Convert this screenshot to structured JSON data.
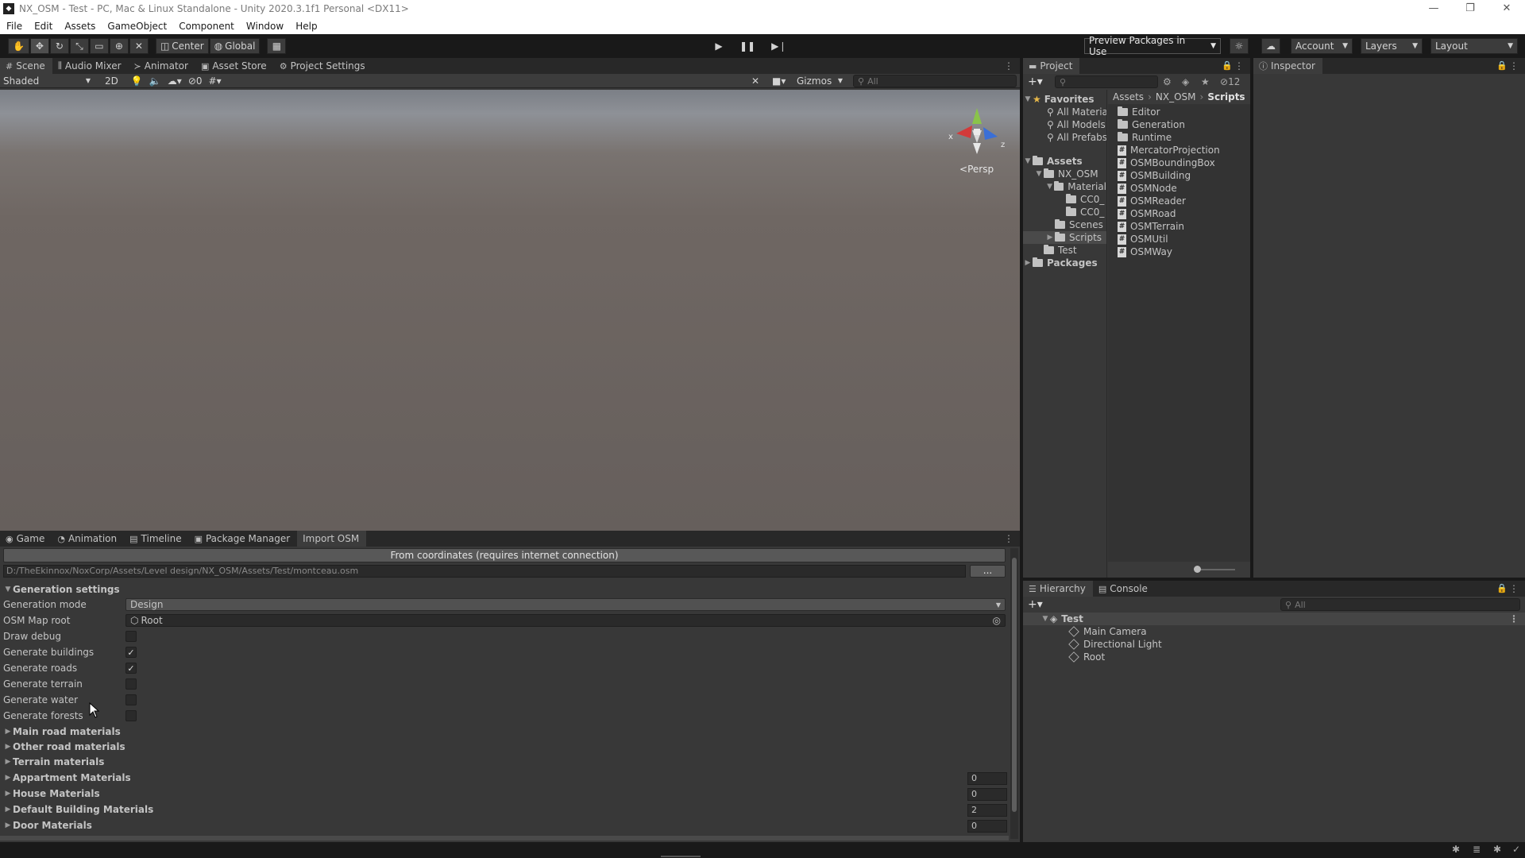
{
  "window": {
    "title": "NX_OSM - Test - PC, Mac & Linux Standalone - Unity 2020.3.1f1 Personal <DX11>",
    "controls": [
      "—",
      "❐",
      "✕"
    ]
  },
  "menu": [
    "File",
    "Edit",
    "Assets",
    "GameObject",
    "Component",
    "Window",
    "Help"
  ],
  "toolbar": {
    "pivot": "Center",
    "space": "Global",
    "preview_packages": "Preview Packages in Use",
    "account": "Account",
    "layers": "Layers",
    "layout": "Layout"
  },
  "scene": {
    "tabs": [
      "Scene",
      "Audio Mixer",
      "Animator",
      "Asset Store",
      "Project Settings"
    ],
    "shading_mode": "Shaded",
    "mode_2d": "2D",
    "hidden_count": "0",
    "gizmos": "Gizmos",
    "search_placeholder": "All",
    "persp_label": "Persp",
    "axis_x": "x",
    "axis_z": "z"
  },
  "bottom": {
    "tabs": [
      "Game",
      "Animation",
      "Timeline",
      "Package Manager",
      "Import OSM"
    ],
    "coords_button": "From coordinates (requires internet connection)",
    "file_path": "D:/TheEkinnox/NoxCorp/Assets/Level design/NX_OSM/Assets/Test/montceau.osm",
    "browse": "...",
    "generation_settings": "Generation settings",
    "props": [
      {
        "label": "Generation mode",
        "value": "Design"
      },
      {
        "label": "OSM Map root",
        "value": "Root"
      }
    ],
    "toggles": [
      {
        "label": "Draw debug",
        "checked": false
      },
      {
        "label": "Generate buildings",
        "checked": true
      },
      {
        "label": "Generate roads",
        "checked": true
      },
      {
        "label": "Generate terrain",
        "checked": false
      },
      {
        "label": "Generate water",
        "checked": false
      },
      {
        "label": "Generate forests",
        "checked": false
      }
    ],
    "foldouts": [
      {
        "label": "Main road materials",
        "count": ""
      },
      {
        "label": "Other road materials",
        "count": ""
      },
      {
        "label": "Terrain materials",
        "count": ""
      },
      {
        "label": "Appartment Materials",
        "count": "0"
      },
      {
        "label": "House Materials",
        "count": "0"
      },
      {
        "label": "Default Building Materials",
        "count": "2"
      },
      {
        "label": "Door Materials",
        "count": "0"
      }
    ]
  },
  "project": {
    "tab": "Project",
    "hidden_count": "12",
    "favorites_label": "Favorites",
    "favorites": [
      "All Materia",
      "All Models",
      "All Prefabs"
    ],
    "tree": [
      {
        "label": "Assets",
        "depth": 0,
        "bold": true
      },
      {
        "label": "NX_OSM",
        "depth": 1
      },
      {
        "label": "Material",
        "depth": 2
      },
      {
        "label": "CC0_",
        "depth": 3
      },
      {
        "label": "CC0_",
        "depth": 3
      },
      {
        "label": "Scenes",
        "depth": 2
      },
      {
        "label": "Scripts",
        "depth": 2,
        "selected": true
      },
      {
        "label": "Test",
        "depth": 1
      },
      {
        "label": "Packages",
        "depth": 0,
        "bold": true
      }
    ],
    "breadcrumb": [
      "Assets",
      "NX_OSM",
      "Scripts"
    ],
    "folders": [
      "Editor",
      "Generation",
      "Runtime"
    ],
    "scripts": [
      "MercatorProjection",
      "OSMBoundingBox",
      "OSMBuilding",
      "OSMNode",
      "OSMReader",
      "OSMRoad",
      "OSMTerrain",
      "OSMUtil",
      "OSMWay"
    ]
  },
  "inspector": {
    "tab": "Inspector"
  },
  "hierarchy": {
    "tabs": [
      "Hierarchy",
      "Console"
    ],
    "search_placeholder": "All",
    "scene_name": "Test",
    "objects": [
      "Main Camera",
      "Directional Light",
      "Root"
    ]
  }
}
